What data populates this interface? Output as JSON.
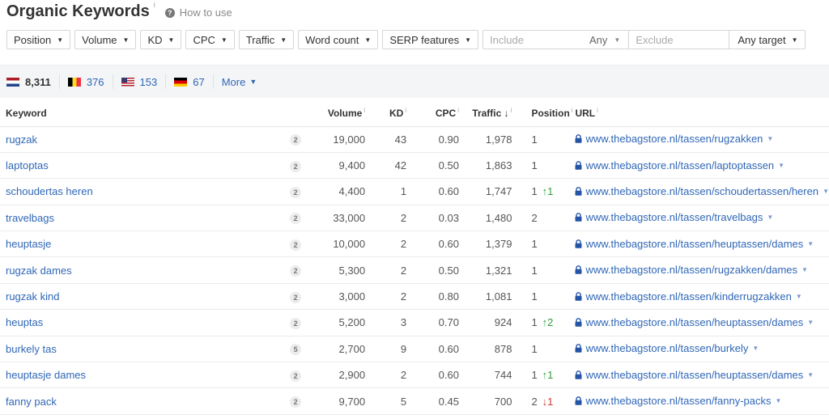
{
  "header": {
    "title": "Organic Keywords",
    "title_info": "i",
    "how_to_icon": "?",
    "how_to_label": "How to use"
  },
  "filters": {
    "buttons": [
      "Position",
      "Volume",
      "KD",
      "CPC",
      "Traffic",
      "Word count",
      "SERP features"
    ],
    "include_placeholder": "Include",
    "any_label": "Any",
    "exclude_placeholder": "Exclude",
    "target_label": "Any target",
    "caret": "▼"
  },
  "countries": [
    {
      "flag": "nl",
      "count": "8,311",
      "active": true
    },
    {
      "flag": "be",
      "count": "376"
    },
    {
      "flag": "us",
      "count": "153"
    },
    {
      "flag": "de",
      "count": "67"
    }
  ],
  "more_label": "More",
  "table": {
    "columns": {
      "keyword": "Keyword",
      "volume": "Volume",
      "kd": "KD",
      "cpc": "CPC",
      "traffic": "Traffic",
      "traffic_sort": "↓",
      "position": "Position",
      "url": "URL",
      "info": "i"
    },
    "rows": [
      {
        "keyword": "rugzak",
        "serp": "2",
        "volume": "19,000",
        "kd": "43",
        "cpc": "0.90",
        "traffic": "1,978",
        "position": "1",
        "change": "",
        "change_dir": "",
        "url": "www.thebagstore.nl/tassen/rugzakken"
      },
      {
        "keyword": "laptoptas",
        "serp": "2",
        "volume": "9,400",
        "kd": "42",
        "cpc": "0.50",
        "traffic": "1,863",
        "position": "1",
        "change": "",
        "change_dir": "",
        "url": "www.thebagstore.nl/tassen/laptoptassen"
      },
      {
        "keyword": "schoudertas heren",
        "serp": "2",
        "volume": "4,400",
        "kd": "1",
        "cpc": "0.60",
        "traffic": "1,747",
        "position": "1",
        "change": "↑1",
        "change_dir": "up",
        "url": "www.thebagstore.nl/tassen/schoudertassen/heren"
      },
      {
        "keyword": "travelbags",
        "serp": "2",
        "volume": "33,000",
        "kd": "2",
        "cpc": "0.03",
        "traffic": "1,480",
        "position": "2",
        "change": "",
        "change_dir": "",
        "url": "www.thebagstore.nl/tassen/travelbags"
      },
      {
        "keyword": "heuptasje",
        "serp": "2",
        "volume": "10,000",
        "kd": "2",
        "cpc": "0.60",
        "traffic": "1,379",
        "position": "1",
        "change": "",
        "change_dir": "",
        "url": "www.thebagstore.nl/tassen/heuptassen/dames"
      },
      {
        "keyword": "rugzak dames",
        "serp": "2",
        "volume": "5,300",
        "kd": "2",
        "cpc": "0.50",
        "traffic": "1,321",
        "position": "1",
        "change": "",
        "change_dir": "",
        "url": "www.thebagstore.nl/tassen/rugzakken/dames"
      },
      {
        "keyword": "rugzak kind",
        "serp": "2",
        "volume": "3,000",
        "kd": "2",
        "cpc": "0.80",
        "traffic": "1,081",
        "position": "1",
        "change": "",
        "change_dir": "",
        "url": "www.thebagstore.nl/tassen/kinderrugzakken"
      },
      {
        "keyword": "heuptas",
        "serp": "2",
        "volume": "5,200",
        "kd": "3",
        "cpc": "0.70",
        "traffic": "924",
        "position": "1",
        "change": "↑2",
        "change_dir": "up",
        "url": "www.thebagstore.nl/tassen/heuptassen/dames"
      },
      {
        "keyword": "burkely tas",
        "serp": "5",
        "volume": "2,700",
        "kd": "9",
        "cpc": "0.60",
        "traffic": "878",
        "position": "1",
        "change": "",
        "change_dir": "",
        "url": "www.thebagstore.nl/tassen/burkely"
      },
      {
        "keyword": "heuptasje dames",
        "serp": "2",
        "volume": "2,900",
        "kd": "2",
        "cpc": "0.60",
        "traffic": "744",
        "position": "1",
        "change": "↑1",
        "change_dir": "up",
        "url": "www.thebagstore.nl/tassen/heuptassen/dames"
      },
      {
        "keyword": "fanny pack",
        "serp": "2",
        "volume": "9,700",
        "kd": "5",
        "cpc": "0.45",
        "traffic": "700",
        "position": "2",
        "change": "↓1",
        "change_dir": "down",
        "url": "www.thebagstore.nl/tassen/fanny-packs"
      }
    ]
  },
  "colors": {
    "link": "#3067b6",
    "up": "#2d9d3a",
    "down": "#d0362f",
    "bar_bg": "#f4f5f7"
  }
}
